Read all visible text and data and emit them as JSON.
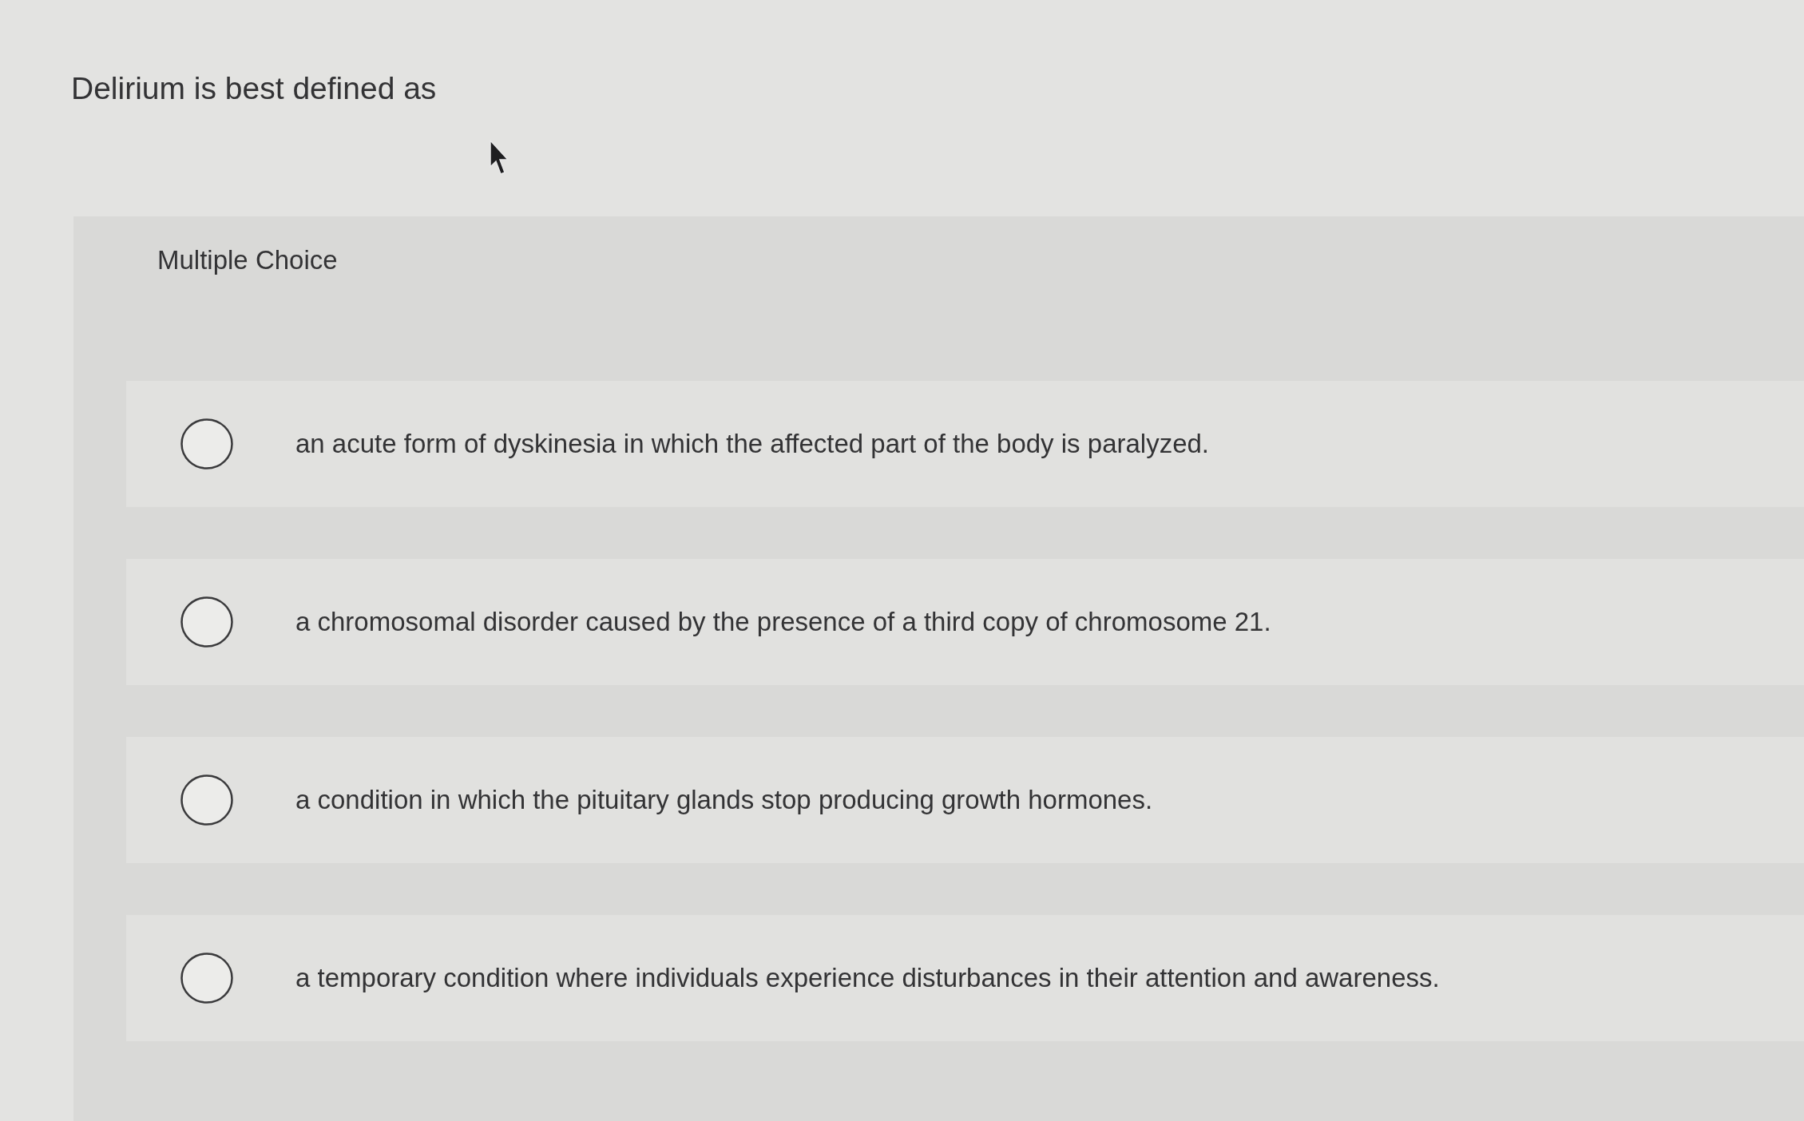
{
  "question": {
    "text": "Delirium is best defined as"
  },
  "section_label": "Multiple Choice",
  "options": [
    {
      "text": "an acute form of dyskinesia in which the affected part of the body is paralyzed.",
      "selected": false
    },
    {
      "text": "a chromosomal disorder caused by the presence of a third copy of chromosome 21.",
      "selected": false
    },
    {
      "text": "a condition in which the pituitary glands stop producing growth hormones.",
      "selected": false
    },
    {
      "text": "a temporary condition where individuals experience disturbances in their attention and awareness.",
      "selected": false
    }
  ]
}
